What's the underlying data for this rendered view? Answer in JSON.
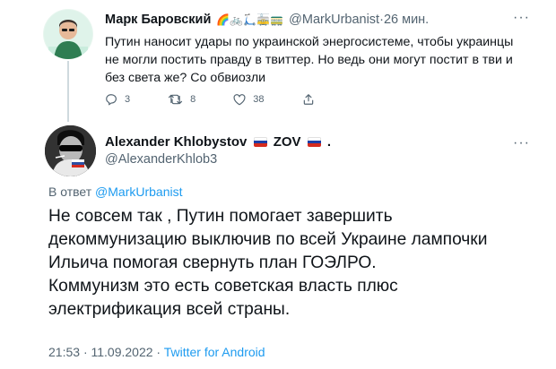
{
  "tweet1": {
    "name": "Марк Баровский",
    "name_emoji": "🌈🚲🛴🚋🚃",
    "handle": "@MarkUrbanist",
    "separator": "·",
    "time": "26 мин.",
    "more": "···",
    "text": "Путин наносит удары по украинской энергосистеме, чтобы украинцы не могли постить правду в твиттер. Но ведь они могут постит в тви и без света же? Со обвиозли",
    "replies": "3",
    "retweets": "8",
    "likes": "38"
  },
  "tweet2": {
    "name": "Alexander Khlobystov",
    "zov": "ZOV",
    "dot": ".",
    "handle": "@AlexanderKhlob3",
    "more": "···",
    "reply_prefix": "В ответ",
    "reply_to": "@MarkUrbanist",
    "text": "Не совсем так , Путин помогает завершить\nдекоммунизацию выключив по всей Украине лампочки\nИльича помогая свернуть план ГОЭЛРО.\nКоммунизм это есть  советская власть плюс\nэлектрификация всей страны.",
    "time": "21:53",
    "sep": "·",
    "date": "11.09.2022",
    "sep2": "·",
    "source": "Twitter for Android"
  },
  "colors": {
    "link": "#1d9bf0",
    "muted": "#536471",
    "text": "#0f1419",
    "thread": "#cfd9de"
  },
  "icons": [
    "reply-icon",
    "retweet-icon",
    "like-icon",
    "share-icon",
    "russian-flag-icon"
  ]
}
